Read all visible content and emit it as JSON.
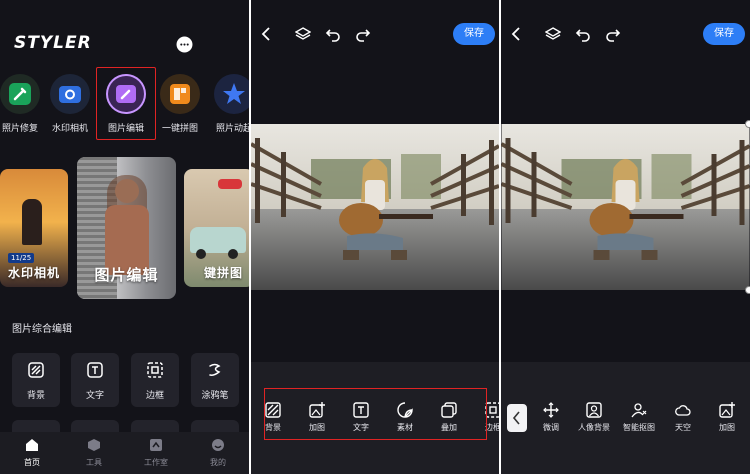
{
  "panel1": {
    "logo": "STYLER",
    "features": [
      {
        "label": "照片修复",
        "icon": "wrench-icon",
        "color": "#1aa35a"
      },
      {
        "label": "水印相机",
        "icon": "camera-icon",
        "color": "#2f6fe0"
      },
      {
        "label": "图片编辑",
        "icon": "edit-icon",
        "color": "#9b4be6"
      },
      {
        "label": "一键拼图",
        "icon": "collage-icon",
        "color": "#f08a1c"
      },
      {
        "label": "照片动起",
        "icon": "star-icon",
        "color": "#2d54d6"
      }
    ],
    "cards": [
      {
        "caption": "水印相机",
        "badge": "11/25"
      },
      {
        "caption": "图片编辑"
      },
      {
        "caption": "键拼图"
      }
    ],
    "section_title": "图片综合编辑",
    "tools": [
      {
        "label": "背景",
        "icon": "background-icon"
      },
      {
        "label": "文字",
        "icon": "text-icon"
      },
      {
        "label": "边框",
        "icon": "border-icon"
      },
      {
        "label": "涂鸦笔",
        "icon": "brush-icon"
      }
    ],
    "nav": [
      {
        "label": "首页",
        "icon": "home-icon",
        "active": true
      },
      {
        "label": "工具",
        "icon": "tools-icon"
      },
      {
        "label": "工作室",
        "icon": "studio-icon"
      },
      {
        "label": "我的",
        "icon": "profile-icon"
      }
    ]
  },
  "panel2": {
    "save_label": "保存",
    "tools": [
      {
        "label": "背景",
        "icon": "background-icon"
      },
      {
        "label": "加图",
        "icon": "add-image-icon"
      },
      {
        "label": "文字",
        "icon": "text-icon"
      },
      {
        "label": "素材",
        "icon": "sticker-icon"
      },
      {
        "label": "叠加",
        "icon": "overlay-icon"
      },
      {
        "label": "边框",
        "icon": "border-icon"
      }
    ]
  },
  "panel3": {
    "save_label": "保存",
    "tools": [
      {
        "label": "微调",
        "icon": "move-icon"
      },
      {
        "label": "人像背景",
        "icon": "portrait-icon"
      },
      {
        "label": "智能抠图",
        "icon": "cutout-icon"
      },
      {
        "label": "天空",
        "icon": "sky-icon"
      },
      {
        "label": "加图",
        "icon": "add-image-icon"
      }
    ]
  },
  "colors": {
    "accent": "#2d7ef6",
    "highlight": "#e02424",
    "background": "#131319"
  }
}
